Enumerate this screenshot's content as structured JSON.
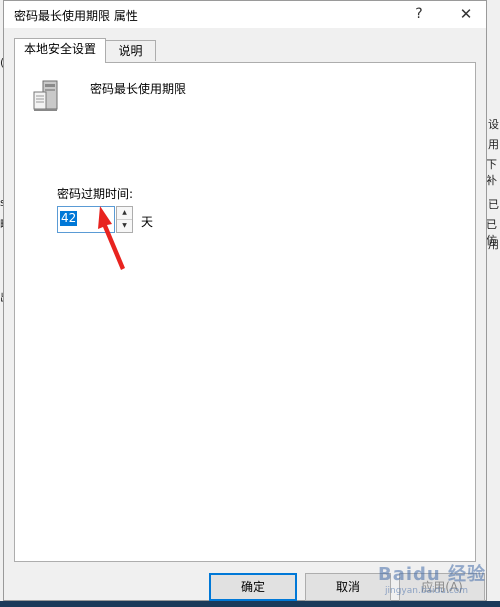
{
  "window": {
    "title": "密码最长使用期限 属性",
    "help_label": "?",
    "close_label": "✕"
  },
  "tabs": [
    {
      "label": "本地安全设置",
      "active": true
    },
    {
      "label": "说明",
      "active": false
    }
  ],
  "policy": {
    "name": "密码最长使用期限",
    "icon": "server-icon"
  },
  "field": {
    "label": "密码过期时间:",
    "value": "42",
    "unit": "天"
  },
  "buttons": {
    "ok": "确定",
    "cancel": "取消",
    "apply": "应用(A)"
  },
  "background_fragments": [
    "(V",
    "设",
    "用",
    "下补",
    "s",
    "已",
    "略",
    "已仿",
    "用",
    "出"
  ],
  "watermark": {
    "text": "Baidu 经验",
    "sub": "jingyan.baidu.com"
  },
  "annotation": {
    "type": "red-arrow",
    "color": "#e8231f"
  }
}
